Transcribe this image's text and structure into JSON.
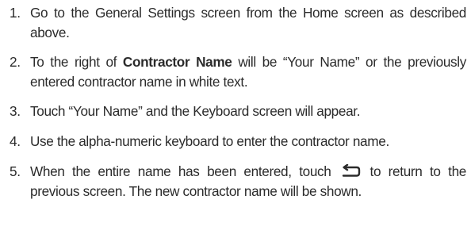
{
  "steps": [
    {
      "number": "1.",
      "text": "Go to the General Settings screen from the Home screen as described above."
    },
    {
      "number": "2.",
      "text_before": "To the right of ",
      "bold_text": "Contractor Name",
      "text_after": " will be “Your Name” or the previously entered contractor name in white text."
    },
    {
      "number": "3.",
      "text": "Touch “Your Name” and the Keyboard screen will appear."
    },
    {
      "number": "4.",
      "text": "Use the alpha-numeric keyboard to enter the contractor name."
    },
    {
      "number": "5.",
      "text_before": "When the entire name has been entered, touch ",
      "icon": "back-arrow-icon",
      "text_after": " to return to the previous screen. The new contractor name will be shown."
    }
  ]
}
